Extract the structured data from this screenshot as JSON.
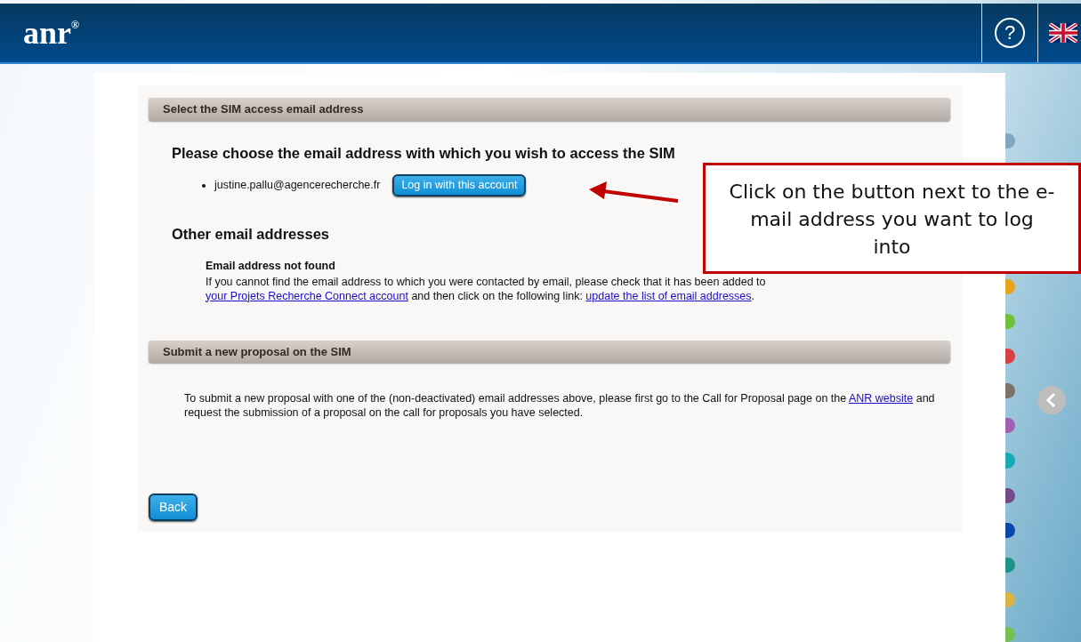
{
  "header": {
    "logo": "anr",
    "logo_mark": "®",
    "help_symbol": "?"
  },
  "sections": [
    {
      "title": "Select the SIM access email address",
      "heading": "Please choose the email address with which you wish to access the SIM",
      "accounts": [
        {
          "email": "justine.pallu@agencerecherche.fr",
          "button": "Log in with this account"
        }
      ],
      "subheading": "Other email addresses",
      "note_title": "Email address not found",
      "note": [
        {
          "kind": "text",
          "text": "If you cannot find the email address to which you were contacted by email, please check that it has been added to "
        },
        {
          "kind": "link",
          "text": "your Projets Recherche Connect account"
        },
        {
          "kind": "text",
          "text": " and then click on the following link: "
        },
        {
          "kind": "link",
          "text": "update the list of email addresses"
        },
        {
          "kind": "text",
          "text": "."
        }
      ]
    },
    {
      "title": "Submit a new proposal on the SIM",
      "note": [
        {
          "kind": "text",
          "text": "To submit a new proposal with one of the (non-deactivated) email addresses above, please first go to the Call for Proposal page on the "
        },
        {
          "kind": "link",
          "text": "ANR website"
        },
        {
          "kind": "text",
          "text": " and request the submission of a proposal on the call for proposals you have selected."
        }
      ]
    }
  ],
  "back_button": "Back",
  "side_tabs": [
    {
      "color": "#7fa8bf"
    },
    {
      "color": "#e8a51c"
    },
    {
      "color": "#6cc03a"
    },
    {
      "color": "#d94044"
    },
    {
      "color": "#7d716b"
    },
    {
      "color": "#a05fb0"
    },
    {
      "color": "#17a9b4"
    },
    {
      "color": "#744a88"
    },
    {
      "color": "#0b47a8"
    },
    {
      "color": "#1f9486"
    },
    {
      "color": "#dcb445"
    },
    {
      "color": "#74c050"
    }
  ],
  "callout": {
    "text": "Click on the button next to the e-mail address you want to log into"
  }
}
